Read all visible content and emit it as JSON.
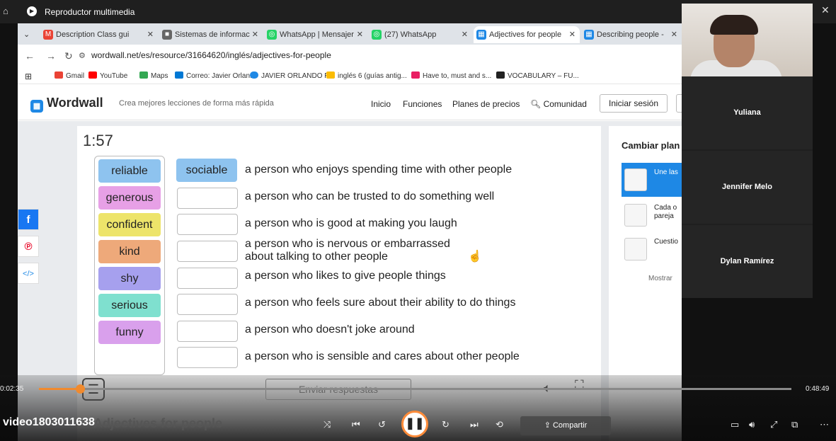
{
  "window": {
    "title": "Reproductor multimedia"
  },
  "tabs": [
    {
      "label": "Description Class gui",
      "color": "#ea4335",
      "glyph": "M"
    },
    {
      "label": "Sistemas de informac",
      "color": "#555",
      "glyph": "■"
    },
    {
      "label": "WhatsApp | Mensajer",
      "color": "#25d366",
      "glyph": "◎"
    },
    {
      "label": "(27) WhatsApp",
      "color": "#25d366",
      "glyph": "◎"
    },
    {
      "label": "Adjectives for people",
      "color": "#1e88e5",
      "glyph": "▦"
    },
    {
      "label": "Describing people - ",
      "color": "#1e88e5",
      "glyph": "▦"
    }
  ],
  "address": {
    "url": "wordwall.net/es/resource/31664620/inglés/adjectives-for-people"
  },
  "bookmarks": [
    {
      "label": "Gmail",
      "color": "#ea4335"
    },
    {
      "label": "YouTube",
      "color": "#ff0000"
    },
    {
      "label": "Maps",
      "color": "#34a853"
    },
    {
      "label": "Correo: Javier Orlan...",
      "color": "#0078d4"
    },
    {
      "label": "JAVIER ORLANDO R...",
      "color": "#1e88e5"
    },
    {
      "label": "inglés 6 (guías antig...",
      "color": "#fbbc04"
    },
    {
      "label": "Have to, must and s...",
      "color": "#e91e63"
    },
    {
      "label": "VOCABULARY – FU...",
      "color": "#222"
    }
  ],
  "header": {
    "logo": "Wordwall",
    "tagline": "Crea mejores lecciones de forma más rápida",
    "menu": [
      "Inicio",
      "Funciones",
      "Planes de precios",
      "Comunidad"
    ],
    "login": "Iniciar sesión"
  },
  "game": {
    "timer": "1:57",
    "words": [
      {
        "label": "reliable",
        "color": "#8ec3ef"
      },
      {
        "label": "generous",
        "color": "#e7a0e6"
      },
      {
        "label": "confident",
        "color": "#ede46a"
      },
      {
        "label": "kind",
        "color": "#eea97a"
      },
      {
        "label": "shy",
        "color": "#a6a0ee"
      },
      {
        "label": "serious",
        "color": "#7fe0cf"
      },
      {
        "label": "funny",
        "color": "#d9a0ec"
      }
    ],
    "placed": "sociable",
    "definitions": [
      "a person who enjoys spending time with other people",
      "a person who can be trusted to do something well",
      "a person who is good at making you laugh",
      "a person who is nervous or embarrassed",
      "about talking to other people",
      "a person who likes to give people things",
      "a person who feels sure about their ability to do things",
      "a person who doesn't joke around",
      "a person who is sensible and cares about other people"
    ],
    "submit": "Enviar respuestas",
    "activity_title": "Adjectives for people"
  },
  "side": {
    "title": "Cambiar plan",
    "options": [
      {
        "line1": "Une las",
        "line2": ""
      },
      {
        "line1": "Cada o",
        "line2": "pareja"
      },
      {
        "line1": "Cuestio",
        "line2": ""
      }
    ],
    "more": "Mostrar"
  },
  "participants": [
    "Yuliana",
    "Jennifer Melo",
    "Dylan Ramírez"
  ],
  "player": {
    "elapsed": "0:02:35",
    "total": "0:48:49",
    "progress": 0.055,
    "filename": "video1803011638",
    "share": "Compartir"
  }
}
